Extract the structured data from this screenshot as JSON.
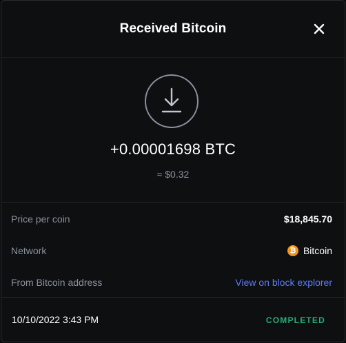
{
  "header": {
    "title": "Received Bitcoin",
    "close_icon": "close-icon"
  },
  "transaction": {
    "icon": "download-icon",
    "amount": "+0.00001698 BTC",
    "fiat_value": "≈ $0.32"
  },
  "details": {
    "price_per_coin_label": "Price per coin",
    "price_per_coin_value": "$18,845.70",
    "network_label": "Network",
    "network_icon": "bitcoin-icon",
    "network_icon_glyph": "₿",
    "network_value": "Bitcoin",
    "from_label": "From Bitcoin address",
    "from_link": "View on block explorer"
  },
  "footer": {
    "datetime": "10/10/2022 3:43 PM",
    "status": "COMPLETED"
  },
  "colors": {
    "background": "#0e0f11",
    "accent_link": "#5b7cfa",
    "status_completed": "#27ad75",
    "bitcoin_orange": "#f7931a",
    "muted_text": "#8a919e"
  }
}
